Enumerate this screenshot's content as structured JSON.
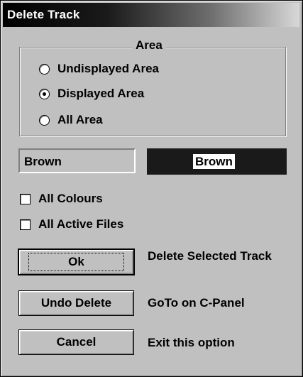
{
  "window": {
    "title": "Delete Track"
  },
  "area_group": {
    "legend": "Area",
    "options": [
      {
        "label": "Undisplayed Area",
        "selected": false
      },
      {
        "label": "Displayed Area",
        "selected": true
      },
      {
        "label": "All Area",
        "selected": false
      }
    ]
  },
  "colour": {
    "name": "Brown",
    "swatch_label": "Brown",
    "swatch_color": "#1a1a1a"
  },
  "checkboxes": {
    "all_colours": {
      "label": "All Colours",
      "checked": false
    },
    "all_active_files": {
      "label": "All Active Files",
      "checked": false
    }
  },
  "buttons": {
    "ok": {
      "label": "Ok",
      "description": "Delete Selected Track"
    },
    "undo_delete": {
      "label": "Undo Delete",
      "description": "GoTo on C-Panel"
    },
    "cancel": {
      "label": "Cancel",
      "description": "Exit this option"
    }
  }
}
